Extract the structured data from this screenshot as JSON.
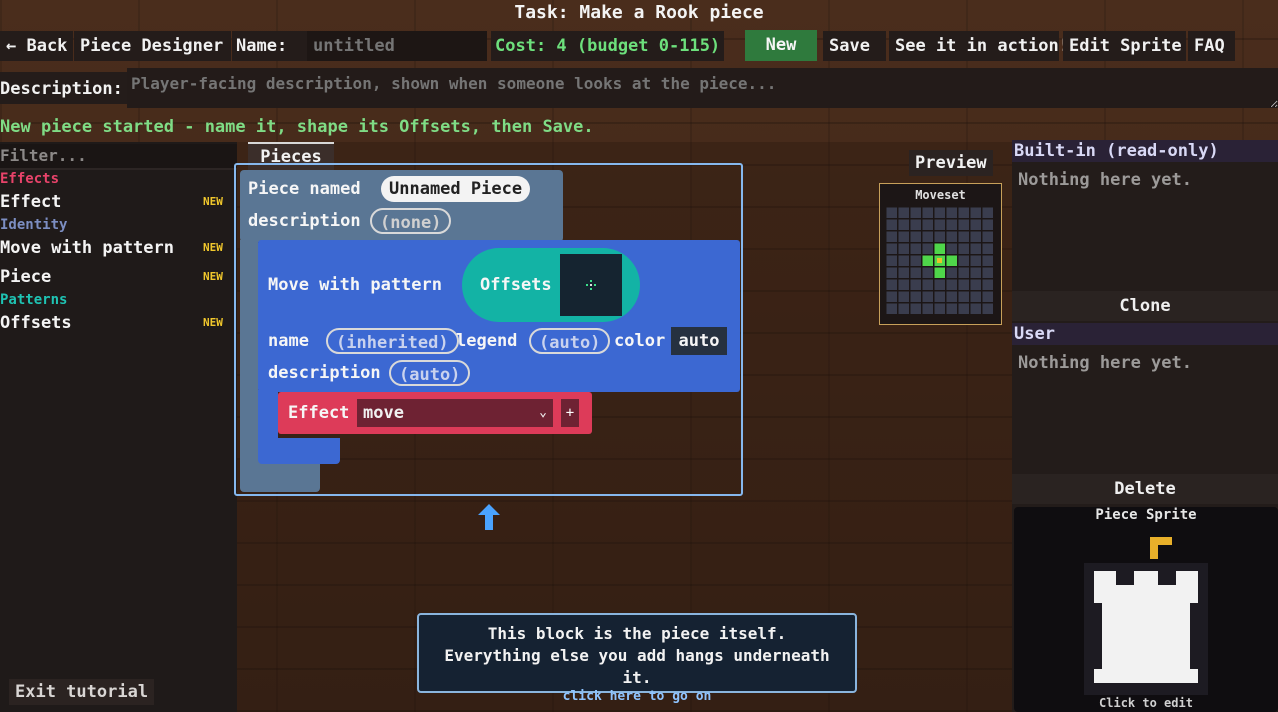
{
  "task_title": "Task: Make a Rook piece",
  "toolbar": {
    "back_label": "← Back",
    "designer_label": "Piece Designer",
    "name_label": "Name:",
    "name_placeholder": "untitled",
    "cost_text": "Cost: 4  (budget 0-115)",
    "new_label": "New",
    "save_label": "Save",
    "see_in_action_label": "See it in action!",
    "edit_sprite_label": "Edit Sprite",
    "faq_label": "FAQ"
  },
  "description": {
    "label": "Description:",
    "placeholder": "Player-facing description, shown when someone looks at the piece..."
  },
  "status_message": "New piece started - name it, shape its Offsets, then Save.",
  "toolbox": {
    "filter_placeholder": "Filter...",
    "categories": [
      {
        "name": "Effects",
        "color": "#e8436a",
        "items": [
          {
            "label": "Effect",
            "badge": "NEW"
          }
        ]
      },
      {
        "name": "Identity",
        "color": "#7c8ec2",
        "items": [
          {
            "label": "Move with pattern",
            "badge": "NEW"
          },
          {
            "label": "Piece",
            "badge": "NEW"
          }
        ]
      },
      {
        "name": "Patterns",
        "color": "#1fc3b3",
        "items": [
          {
            "label": "Offsets",
            "badge": "NEW"
          }
        ]
      }
    ],
    "exit_tutorial_label": "Exit tutorial"
  },
  "workspace": {
    "tab_label": "Pieces",
    "piece_block": {
      "named_label": "Piece named",
      "name_value": "Unnamed Piece",
      "description_label": "description",
      "description_value": "(none)"
    },
    "move_block": {
      "label": "Move with pattern",
      "offsets_label": "Offsets",
      "name_label": "name",
      "name_value": "(inherited)",
      "legend_label": "legend",
      "legend_value": "(auto)",
      "color_label": "color",
      "color_value": "auto",
      "description_label": "description",
      "description_value": "(auto)"
    },
    "effect_block": {
      "label": "Effect",
      "selected": "move",
      "plus_label": "+"
    }
  },
  "preview": {
    "label": "Preview",
    "moveset_title": "Moveset",
    "grid_size": 9,
    "center": [
      4,
      4
    ],
    "move_cells": [
      [
        3,
        4
      ],
      [
        5,
        4
      ],
      [
        4,
        3
      ],
      [
        4,
        5
      ]
    ],
    "colors": {
      "cell": "#3a3d4e",
      "move": "#4fd64a",
      "center": "#e8c32a",
      "bg": "#1c1616",
      "border": "#c7a05a"
    }
  },
  "sidebar": {
    "builtin_header": "Built-in (read-only)",
    "builtin_empty": "Nothing here yet.",
    "clone_label": "Clone",
    "user_header": "User",
    "user_empty": "Nothing here yet.",
    "delete_label": "Delete",
    "sprite_title": "Piece Sprite",
    "sprite_caption": "Click to edit"
  },
  "tutorial": {
    "text": "This block is the piece itself. Everything else you add hangs underneath it.",
    "link": "click here to go on"
  },
  "colors": {
    "accent_green": "#2f7a3d",
    "cost_green": "#6de07c",
    "piece_block": "#5a7694",
    "move_block": "#3c68d2",
    "offsets": "#13b3a5",
    "effect": "#dd3b59"
  }
}
